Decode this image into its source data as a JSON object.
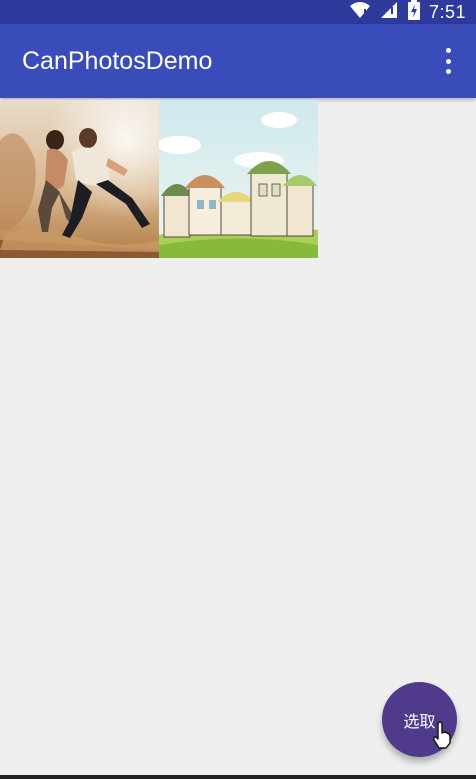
{
  "status_bar": {
    "time": "7:51",
    "icons": [
      "wifi-icon",
      "signal-icon",
      "battery-charging-icon"
    ]
  },
  "app_bar": {
    "title": "CanPhotosDemo",
    "overflow_icon": "more-vert-icon"
  },
  "photos": [
    {
      "name": "photo-action-couple-running"
    },
    {
      "name": "photo-cartoon-houses"
    }
  ],
  "fab": {
    "label": "选取"
  },
  "colors": {
    "status_bar": "#2e3b9c",
    "app_bar": "#3a4cb9",
    "background": "#efefef",
    "fab": "#4f3a8c"
  }
}
